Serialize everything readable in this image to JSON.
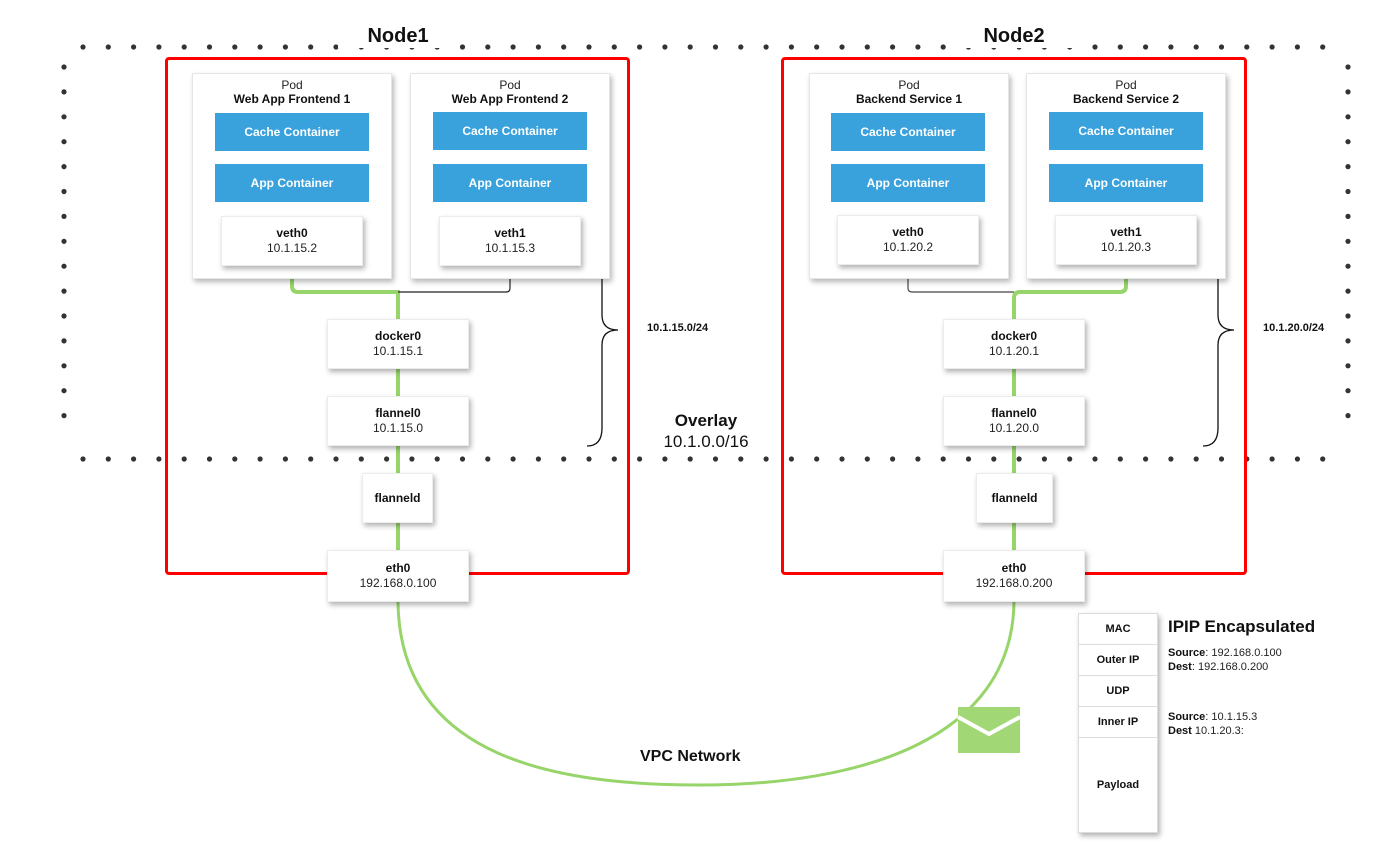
{
  "overlay": {
    "title": "Overlay",
    "cidr": "10.1.0.0/16"
  },
  "vpc_label": "VPC Network",
  "nodes": [
    {
      "title": "Node1",
      "subnet": "10.1.15.0/24",
      "pods": [
        {
          "kind": "Pod",
          "name": "Web App Frontend 1",
          "containers": [
            "Cache Container",
            "App Container"
          ],
          "veth": {
            "name": "veth0",
            "ip": "10.1.15.2"
          }
        },
        {
          "kind": "Pod",
          "name": "Web App Frontend 2",
          "containers": [
            "Cache Container",
            "App Container"
          ],
          "veth": {
            "name": "veth1",
            "ip": "10.1.15.3"
          }
        }
      ],
      "docker0": {
        "name": "docker0",
        "ip": "10.1.15.1"
      },
      "flannel0": {
        "name": "flannel0",
        "ip": "10.1.15.0"
      },
      "flanneld": {
        "name": "flanneld"
      },
      "eth0": {
        "name": "eth0",
        "ip": "192.168.0.100"
      }
    },
    {
      "title": "Node2",
      "subnet": "10.1.20.0/24",
      "pods": [
        {
          "kind": "Pod",
          "name": "Backend Service 1",
          "containers": [
            "Cache Container",
            "App Container"
          ],
          "veth": {
            "name": "veth0",
            "ip": "10.1.20.2"
          }
        },
        {
          "kind": "Pod",
          "name": "Backend Service 2",
          "containers": [
            "Cache Container",
            "App Container"
          ],
          "veth": {
            "name": "veth1",
            "ip": "10.1.20.3"
          }
        }
      ],
      "docker0": {
        "name": "docker0",
        "ip": "10.1.20.1"
      },
      "flannel0": {
        "name": "flannel0",
        "ip": "10.1.20.0"
      },
      "flanneld": {
        "name": "flanneld"
      },
      "eth0": {
        "name": "eth0",
        "ip": "192.168.0.200"
      }
    }
  ],
  "packet": {
    "title": "IPIP Encapsulated",
    "layers": [
      "MAC",
      "Outer IP",
      "UDP",
      "Inner IP",
      "Payload"
    ],
    "outer": {
      "source_label": "Source",
      "source": ": 192.168.0.100",
      "dest_label": "Dest",
      "dest": ": 192.168.0.200"
    },
    "inner": {
      "source_label": "Source",
      "source": ": 10.1.15.3",
      "dest_label": "Dest",
      "dest": " 10.1.20.3:"
    }
  },
  "icons": {
    "packet": "envelope-icon"
  },
  "colors": {
    "node_border": "#ff0000",
    "container": "#39a1dc",
    "active_link": "#97d56a",
    "inactive_link": "#222222",
    "overlay_dots": "#333333"
  }
}
